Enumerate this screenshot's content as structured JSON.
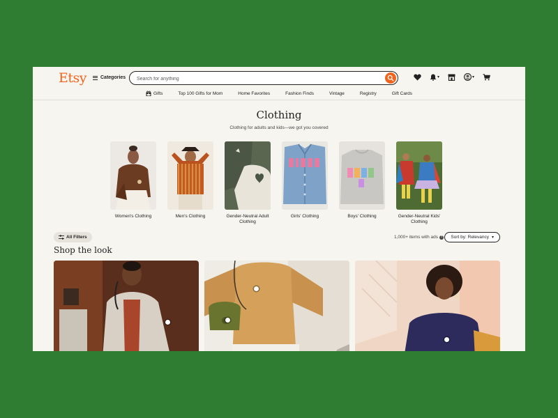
{
  "header": {
    "logo": "Etsy",
    "categories_label": "Categories",
    "search_placeholder": "Search for anything"
  },
  "nav": {
    "items": [
      "Gifts",
      "Top 100 Gifts for Mom",
      "Home Favorites",
      "Fashion Finds",
      "Vintage",
      "Registry",
      "Gift Cards"
    ]
  },
  "page": {
    "title": "Clothing",
    "subtitle": "Clothing for adults and kids—we got you covered"
  },
  "categories": [
    {
      "label": "Women's Clothing"
    },
    {
      "label": "Men's Clothing"
    },
    {
      "label": "Gender-Neutral Adult Clothing"
    },
    {
      "label": "Girls' Clothing"
    },
    {
      "label": "Boys' Clothing"
    },
    {
      "label": "Gender-Neutral Kids' Clothing"
    }
  ],
  "filters": {
    "all_filters_label": "All Filters",
    "results_count": "1,000+ items with ads",
    "sort_label": "Sort by: Relevancy"
  },
  "shop_the_look": {
    "title": "Shop the look"
  },
  "colors": {
    "brand": "#f1641e",
    "background": "#2e7d32",
    "page": "#f7f5f0"
  }
}
